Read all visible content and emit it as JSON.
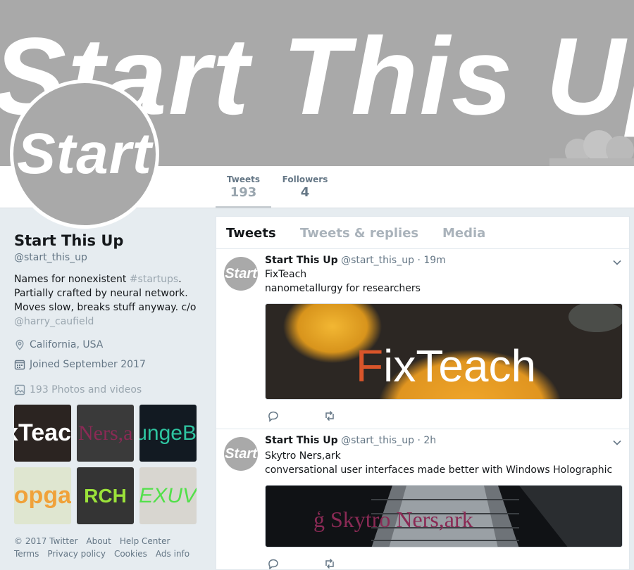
{
  "banner": {
    "text": "Start This Up",
    "color": "#a9a9a9"
  },
  "avatar": {
    "text": "Start"
  },
  "stats": [
    {
      "label": "Tweets",
      "value": "193"
    },
    {
      "label": "Followers",
      "value": "4"
    }
  ],
  "profile": {
    "name": "Start This Up",
    "handle": "@start_this_up",
    "bio_1": "Names for nonexistent ",
    "bio_hashtag": "#startups",
    "bio_2": ".",
    "bio_3": "Partially crafted by neural network.",
    "bio_4": "Moves slow, breaks stuff anyway. c/o",
    "bio_mention": "@harry_caufield",
    "location": "California, USA",
    "joined": "Joined September 2017",
    "photos": "193 Photos and videos"
  },
  "photo_thumbs": [
    "xTeac",
    "Ners,a",
    "ungeB",
    "opga",
    "RCH",
    "EXUV"
  ],
  "footer": {
    "row1": [
      "© 2017 Twitter",
      "About",
      "Help Center"
    ],
    "row2": [
      "Terms",
      "Privacy policy",
      "Cookies",
      "Ads info"
    ]
  },
  "tabs": [
    "Tweets",
    "Tweets & replies",
    "Media"
  ],
  "tweets": [
    {
      "name": "Start This Up",
      "handle": "@start_this_up",
      "time": "· 19m",
      "avatar_text": "Start",
      "line1": "FixTeach",
      "line2": "nanometallurgy for researchers",
      "media_first": "F",
      "media_rest": "ixTeach"
    },
    {
      "name": "Start This Up",
      "handle": "@start_this_up",
      "time": "· 2h",
      "avatar_text": "Start",
      "line1": "Skytro Ners,ark",
      "line2": "conversational user interfaces made better with Windows Holographic",
      "media_glyph": "ģ",
      "media_text": "Skytro Ners,ark"
    }
  ],
  "colors": {
    "accent_text": "#14171a",
    "muted": "#657786",
    "fixteach_f": "#d9552a",
    "skytro": "#8a2a55"
  }
}
